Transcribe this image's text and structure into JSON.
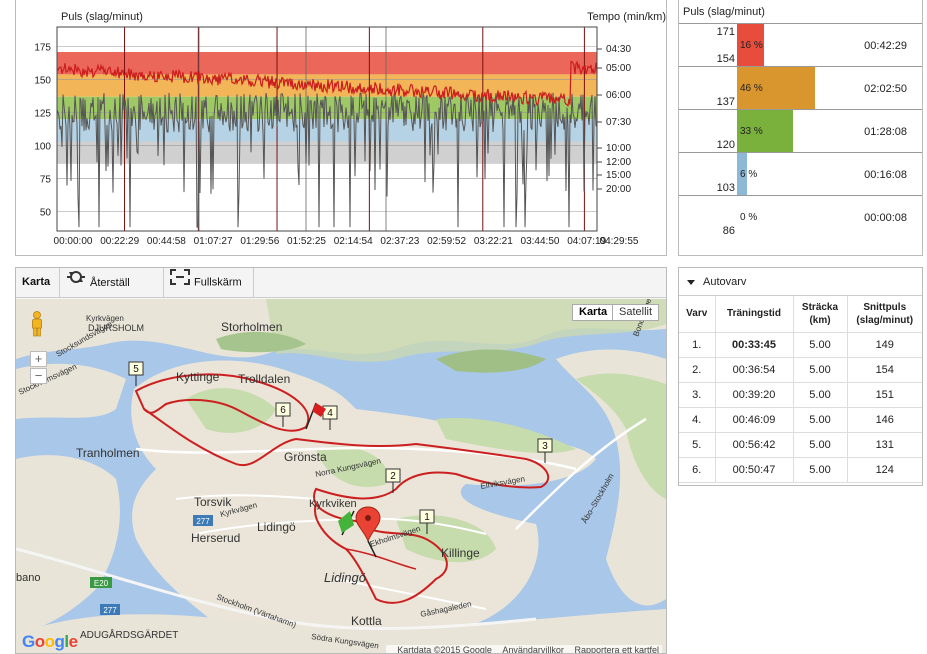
{
  "chart": {
    "left_axis_title": "Puls (slag/minut)",
    "right_axis_title": "Tempo (min/km)",
    "left_ticks": [
      "175",
      "150",
      "125",
      "100",
      "75",
      "50"
    ],
    "right_ticks": [
      "04:30",
      "05:00",
      "06:00",
      "07:30",
      "10:00",
      "12:00",
      "15:00",
      "20:00"
    ],
    "x_ticks": [
      "00:00:00",
      "00:22:29",
      "00:44:58",
      "01:07:27",
      "01:29:56",
      "01:52:25",
      "02:14:54",
      "02:37:23",
      "02:59:52",
      "03:22:21",
      "03:44:50",
      "04:07:19",
      "04:29:55"
    ],
    "zone_colors": [
      "#e74c3c",
      "#f0a83a",
      "#8dc04a",
      "#a9cbe0",
      "#c8c8c8"
    ],
    "lap_markers": [
      "00:33:45",
      "01:10:39",
      "01:49:59",
      "02:36:08",
      "03:32:50",
      "04:23:37"
    ]
  },
  "chart_data": {
    "type": "line",
    "title": "",
    "ylabel": "Puls (slag/minut)",
    "y2label": "Tempo (min/km)",
    "ylim": [
      35,
      190
    ],
    "y2ticks": [
      "04:30",
      "05:00",
      "06:00",
      "07:30",
      "10:00",
      "12:00",
      "15:00",
      "20:00"
    ],
    "xlim": [
      "00:00:00",
      "04:29:55"
    ],
    "zones": [
      {
        "from": 154,
        "to": 171,
        "color": "#e74c3c"
      },
      {
        "from": 137,
        "to": 154,
        "color": "#f0a83a"
      },
      {
        "from": 120,
        "to": 137,
        "color": "#8dc04a"
      },
      {
        "from": 103,
        "to": 120,
        "color": "#a9cbe0"
      },
      {
        "from": 86,
        "to": 103,
        "color": "#c8c8c8"
      }
    ],
    "series": [
      {
        "name": "Puls (slag/minut)",
        "color": "#cc1d1d",
        "style": "solid"
      },
      {
        "name": "Tempo (min/km)",
        "color": "#555555",
        "style": "solid"
      }
    ]
  },
  "zones": {
    "title": "Puls (slag/minut)",
    "rows": [
      {
        "top": "171",
        "bottom": "154",
        "pct": "16 %",
        "fraction": 0.16,
        "time": "00:42:29",
        "color": "#e74c3c"
      },
      {
        "top": "",
        "bottom": "137",
        "pct": "46 %",
        "fraction": 0.46,
        "time": "02:02:50",
        "color": "#d9962e"
      },
      {
        "top": "",
        "bottom": "120",
        "pct": "33 %",
        "fraction": 0.33,
        "time": "01:28:08",
        "color": "#7ab13c"
      },
      {
        "top": "",
        "bottom": "103",
        "pct": "6 %",
        "fraction": 0.06,
        "time": "00:16:08",
        "color": "#8db8d6"
      },
      {
        "top": "",
        "bottom": "86",
        "pct": "0 %",
        "fraction": 0.0,
        "time": "00:00:08",
        "color": "#bbbbbb"
      }
    ]
  },
  "map": {
    "tab_label": "Karta",
    "reset_label": "Återställ karta",
    "fullscreen_label": "Fullskärm",
    "type_map": "Karta",
    "type_satellite": "Satellit",
    "zoom_in": "+",
    "zoom_out": "−",
    "google": "Google",
    "footer_data": "Kartdata ©2015 Google",
    "footer_terms": "Användarvillkor",
    "footer_report": "Rapportera ett kartfel",
    "places": {
      "storholmen": "Storholmen",
      "trolldalen": "Trolldalen",
      "kyttinge": "Kyttinge",
      "djursholm": "DJURSHOLM",
      "tranholmen": "Tranholmen",
      "gronsta": "Grönsta",
      "torsvik": "Torsvik",
      "lidingo": "Lidingö",
      "lidingo2": "Lidingö",
      "kyrkviken": "Kyrkviken",
      "herserud": "Herserud",
      "killinge": "Killinge",
      "kottla": "Kottla",
      "bano": "bano",
      "adugardsgardet": "ADUGÅRDSGÄRDET"
    },
    "roads": {
      "r1": "Norra Kungsvägen",
      "r2": "Elfviksvägen",
      "r3": "Kyrkvägen",
      "r4": "Ekholmsvägen",
      "r5": "Gåshagaleden",
      "r6": "Södra Kungsvägen",
      "r7": "Stockholm (Värtahamn)",
      "r8": "Stocksundsvägen",
      "r9": "Åbo–Stockholm",
      "r10": "Bondsvägen",
      "r11": "Kyrkvägen",
      "r12": "Stockholmsvägen"
    },
    "shields": {
      "s1": "277",
      "s2": "E20",
      "s3": "277"
    },
    "markers": [
      "1",
      "2",
      "3",
      "4",
      "5",
      "6"
    ]
  },
  "laps": {
    "title": "Autovarv",
    "headers": [
      "Varv",
      "Träningstid",
      "Sträcka (km)",
      "Snittpuls (slag/minut)"
    ],
    "rows": [
      [
        "1.",
        "00:33:45",
        "5.00",
        "149"
      ],
      [
        "2.",
        "00:36:54",
        "5.00",
        "154"
      ],
      [
        "3.",
        "00:39:20",
        "5.00",
        "151"
      ],
      [
        "4.",
        "00:46:09",
        "5.00",
        "146"
      ],
      [
        "5.",
        "00:56:42",
        "5.00",
        "131"
      ],
      [
        "6.",
        "00:50:47",
        "5.00",
        "124"
      ]
    ]
  }
}
